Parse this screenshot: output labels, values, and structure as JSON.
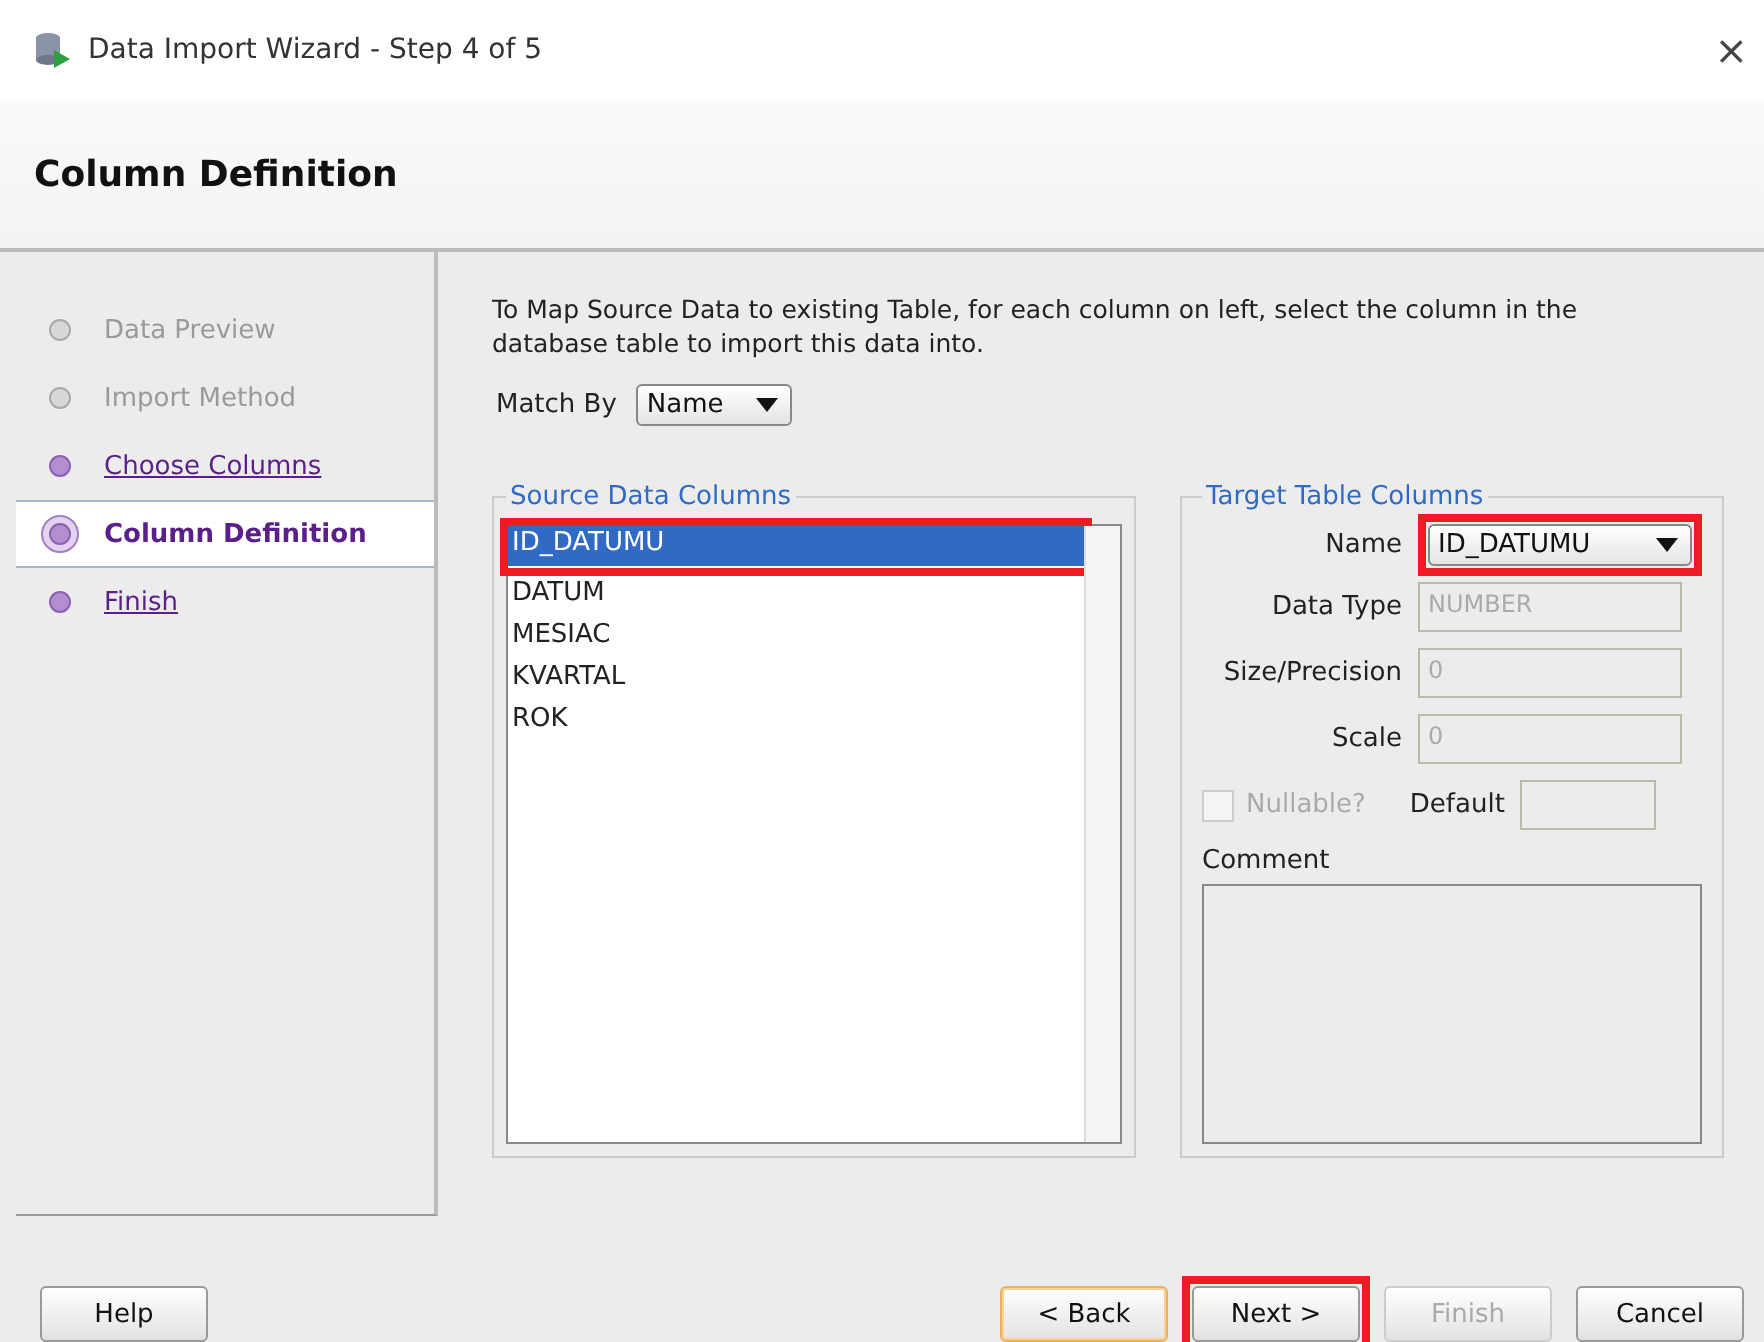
{
  "window": {
    "title": "Data Import Wizard - Step 4 of 5",
    "close": "×"
  },
  "header": {
    "title": "Column Definition"
  },
  "steps": [
    {
      "label": "Data Preview",
      "kind": "disabled",
      "selected": false
    },
    {
      "label": "Import Method",
      "kind": "disabled",
      "selected": false
    },
    {
      "label": "Choose Columns",
      "kind": "link",
      "selected": false
    },
    {
      "label": "Column Definition",
      "kind": "current",
      "selected": true
    },
    {
      "label": "Finish",
      "kind": "link",
      "selected": false
    }
  ],
  "instructions": "To Map Source Data to existing Table, for each column on left, select the column in the database table to import this data into.",
  "match_by": {
    "label": "Match By",
    "value": "Name"
  },
  "source": {
    "legend": "Source Data Columns",
    "items": [
      {
        "label": "ID_DATUMU",
        "selected": true,
        "highlighted": true
      },
      {
        "label": "DATUM",
        "selected": false,
        "highlighted": false
      },
      {
        "label": "MESIAC",
        "selected": false,
        "highlighted": false
      },
      {
        "label": "KVARTAL",
        "selected": false,
        "highlighted": false
      },
      {
        "label": "ROK",
        "selected": false,
        "highlighted": false
      }
    ]
  },
  "target": {
    "legend": "Target Table Columns",
    "name": {
      "label": "Name",
      "value": "ID_DATUMU",
      "highlighted": true
    },
    "fields": [
      {
        "label": "Data Type",
        "value": "NUMBER",
        "disabled": true
      },
      {
        "label": "Size/Precision",
        "value": "0",
        "disabled": true
      },
      {
        "label": "Scale",
        "value": "0",
        "disabled": true
      }
    ],
    "nullable": {
      "label": "Nullable?",
      "checked": false,
      "disabled": true
    },
    "default": {
      "label": "Default"
    },
    "comment": {
      "label": "Comment"
    }
  },
  "buttons": [
    {
      "label": "Help",
      "kind": "left",
      "disabled": false,
      "focused": false,
      "highlighted": false
    },
    {
      "label": "< Back",
      "kind": "right",
      "disabled": false,
      "focused": true,
      "highlighted": false
    },
    {
      "label": "Next >",
      "kind": "right",
      "disabled": false,
      "focused": false,
      "highlighted": true
    },
    {
      "label": "Finish",
      "kind": "right",
      "disabled": true,
      "focused": false,
      "highlighted": false
    },
    {
      "label": "Cancel",
      "kind": "right",
      "disabled": false,
      "focused": false,
      "highlighted": false
    }
  ]
}
